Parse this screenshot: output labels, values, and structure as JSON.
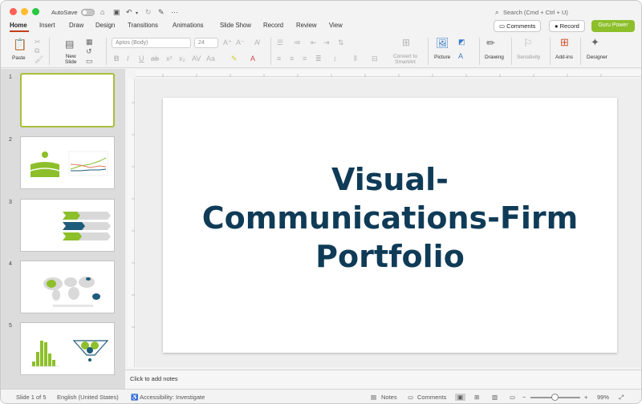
{
  "titlebar": {
    "autosave_label": "AutoSave",
    "search_placeholder": "Search (Cmd + Ctrl + U)"
  },
  "tabs": [
    {
      "label": "Home"
    },
    {
      "label": "Insert"
    },
    {
      "label": "Draw"
    },
    {
      "label": "Design"
    },
    {
      "label": "Transitions"
    },
    {
      "label": "Animations"
    },
    {
      "label": "Slide Show"
    },
    {
      "label": "Record"
    },
    {
      "label": "Review"
    },
    {
      "label": "View"
    }
  ],
  "actions": {
    "comments": "Comments",
    "record": "Record",
    "guru": "Guru Power"
  },
  "ribbon": {
    "paste": "Paste",
    "new_slide_line1": "New",
    "new_slide_line2": "Slide",
    "font_name": "Aptos (Body)",
    "font_size": "24",
    "convert_line1": "Convert to",
    "convert_line2": "SmartArt",
    "picture": "Picture",
    "drawing": "Drawing",
    "sensitivity": "Sensitivity",
    "addins": "Add-ins",
    "designer": "Designer"
  },
  "thumbnails": [
    {
      "num": "1"
    },
    {
      "num": "2"
    },
    {
      "num": "3"
    },
    {
      "num": "4"
    },
    {
      "num": "5"
    }
  ],
  "slide": {
    "title_line1": "Visual-",
    "title_line2": "Communications-Firm",
    "title_line3": "Portfolio"
  },
  "notes_placeholder": "Click to add notes",
  "status": {
    "slide_count": "Slide 1 of 5",
    "language": "English (United States)",
    "accessibility": "Accessibility: Investigate",
    "notes": "Notes",
    "comments": "Comments",
    "zoom": "99%"
  },
  "colors": {
    "accent_green": "#8dbf2a",
    "title_navy": "#0f3b57",
    "tab_red": "#c43e1c"
  }
}
